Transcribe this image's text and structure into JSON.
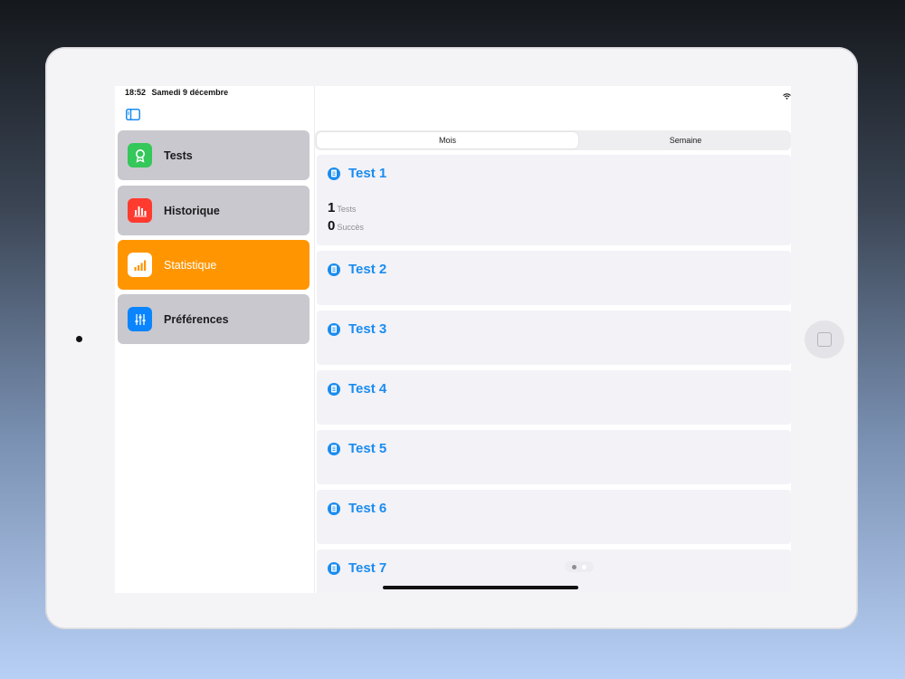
{
  "status": {
    "time": "18:52",
    "date": "Samedi 9 décembre"
  },
  "sidebar": {
    "items": [
      {
        "label": "Tests",
        "icon": "award-icon",
        "color": "#34c759",
        "active": false
      },
      {
        "label": "Historique",
        "icon": "bar-chart-icon",
        "color": "#ff3b30",
        "active": false
      },
      {
        "label": "Statistique",
        "icon": "signal-bars-icon",
        "color": "#ffffff",
        "active": true
      },
      {
        "label": "Préférences",
        "icon": "sliders-icon",
        "color": "#0a84ff",
        "active": false
      }
    ]
  },
  "segments": {
    "selected": "Mois",
    "other": "Semaine"
  },
  "cards": [
    {
      "title": "Test 1",
      "tests_count": "1",
      "tests_label": "Tests",
      "success_count": "0",
      "success_label": "Succès"
    },
    {
      "title": "Test 2"
    },
    {
      "title": "Test 3"
    },
    {
      "title": "Test 4"
    },
    {
      "title": "Test 5"
    },
    {
      "title": "Test 6"
    },
    {
      "title": "Test 7"
    }
  ],
  "colors": {
    "accent": "#1a8cf0",
    "active_nav": "#ff9500"
  }
}
